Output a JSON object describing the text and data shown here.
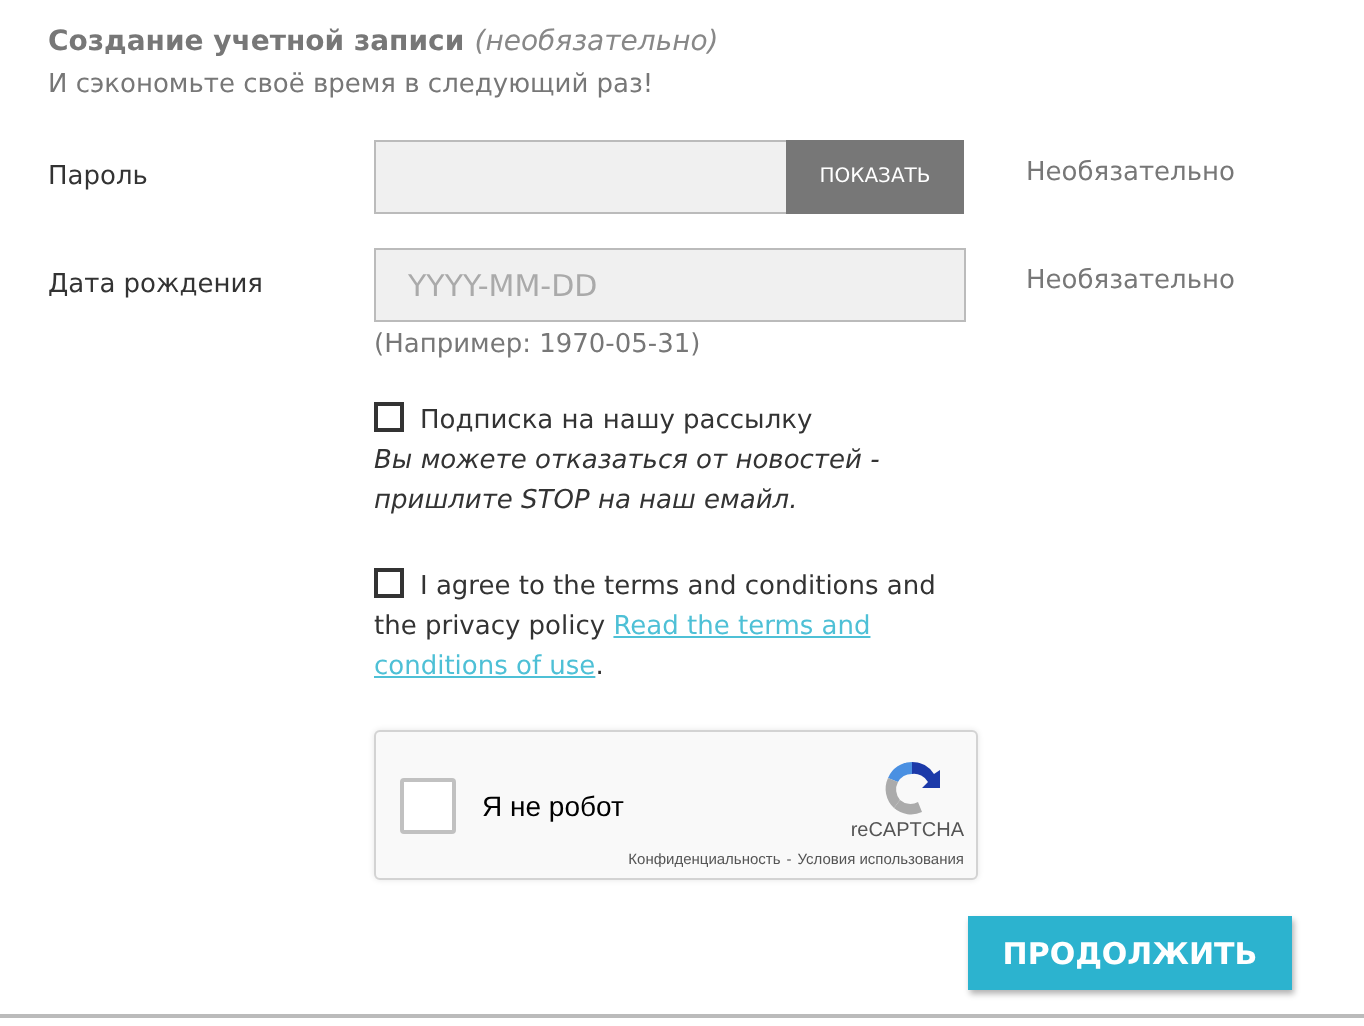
{
  "header": {
    "title": "Создание учетной записи",
    "title_note": "(необязательно)",
    "subtitle": "И сэкономьте своё время в следующий раз!"
  },
  "fields": [
    {
      "kind": "password",
      "label": "Пароль",
      "button": "ПОКАЗАТЬ",
      "hint": "Необязательно"
    },
    {
      "kind": "date",
      "label": "Дата рождения",
      "placeholder": "YYYY-MM-DD",
      "hint": "Необязательно",
      "example": "(Например: 1970-05-31)"
    }
  ],
  "checkboxes": [
    {
      "label": "Подписка на нашу рассылку",
      "checked": false,
      "note": "Вы можете отказаться от новостей - пришлите STOP на наш емайл."
    },
    {
      "label": "I agree to the terms and conditions and",
      "label_rest": "the privacy policy",
      "checked": false,
      "link": [
        "Read the terms and",
        "conditions of use"
      ],
      "after": "."
    }
  ],
  "captcha": {
    "label": "Я не робот",
    "checked": false,
    "brand": "reCAPTCHA",
    "privacy": "Конфиденциальность",
    "separator": "-",
    "terms": "Условия использования"
  },
  "submit": "ПРОДОЛЖИТЬ"
}
